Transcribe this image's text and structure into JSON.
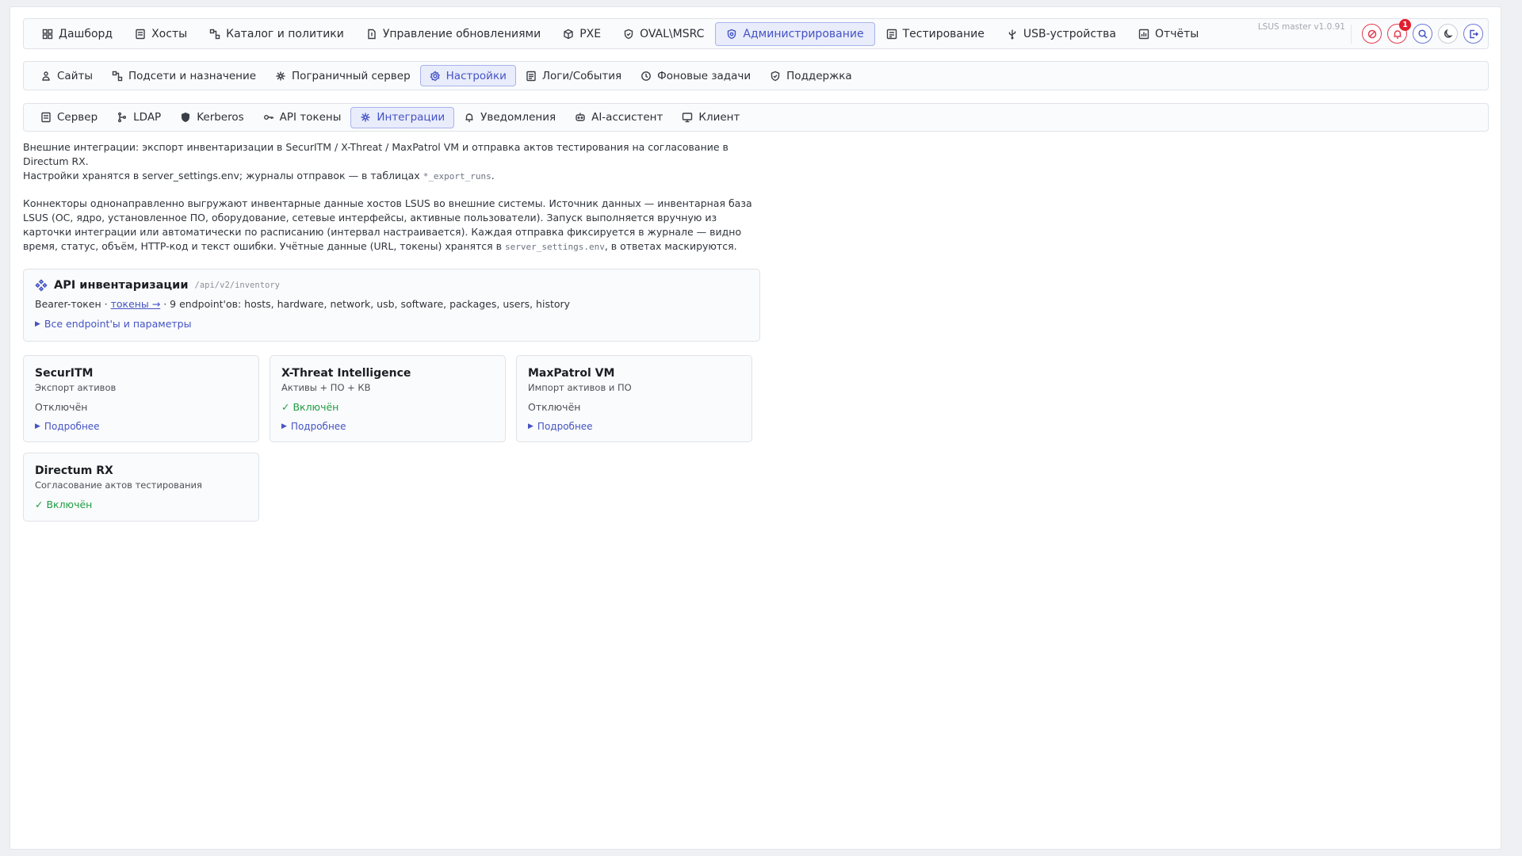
{
  "header": {
    "nav": [
      {
        "label": "Дашборд",
        "icon": "dashboard-icon"
      },
      {
        "label": "Хосты",
        "icon": "server-icon"
      },
      {
        "label": "Каталог и политики",
        "icon": "network-icon"
      },
      {
        "label": "Управление обновлениями",
        "icon": "file-icon"
      },
      {
        "label": "PXE",
        "icon": "box-icon"
      },
      {
        "label": "OVAL\\MSRC",
        "icon": "shield-icon"
      },
      {
        "label": "Администрирование",
        "icon": "gear-shield-icon",
        "active": true
      },
      {
        "label": "Тестирование",
        "icon": "checklist-icon"
      },
      {
        "label": "USB-устройства",
        "icon": "usb-icon"
      },
      {
        "label": "Отчёты",
        "icon": "chart-icon"
      }
    ],
    "version": "LSUS master v1.0.91",
    "notification_count": "1"
  },
  "subnav": [
    {
      "label": "Сайты",
      "icon": "sites-icon"
    },
    {
      "label": "Подсети и назначение",
      "icon": "network-icon"
    },
    {
      "label": "Пограничный сервер",
      "icon": "edge-icon"
    },
    {
      "label": "Настройки",
      "icon": "gear-icon",
      "active": true
    },
    {
      "label": "Логи/События",
      "icon": "log-icon"
    },
    {
      "label": "Фоновые задачи",
      "icon": "clock-icon"
    },
    {
      "label": "Поддержка",
      "icon": "shield-icon"
    }
  ],
  "settings_tabs": [
    {
      "label": "Сервер",
      "icon": "server-icon"
    },
    {
      "label": "LDAP",
      "icon": "tree-icon"
    },
    {
      "label": "Kerberos",
      "icon": "shield-icon"
    },
    {
      "label": "API токены",
      "icon": "key-icon"
    },
    {
      "label": "Интеграции",
      "icon": "integrations-icon",
      "active": true
    },
    {
      "label": "Уведомления",
      "icon": "bell-icon"
    },
    {
      "label": "AI-ассистент",
      "icon": "robot-icon"
    },
    {
      "label": "Клиент",
      "icon": "client-icon"
    }
  ],
  "intro": {
    "line1_a": "Внешние интеграции: экспорт инвентаризации в SecurITM / X-Threat / MaxPatrol VM и отправка актов тестирования на согласование в Directum RX.",
    "line1_b": "Настройки хранятся в server_settings.env; журналы отправок — в таблицах ",
    "line1_code": "*_export_runs",
    "line1_end": ".",
    "para2_a": "Коннекторы однонаправленно выгружают инвентарные данные хостов LSUS во внешние системы. Источник данных — инвентарная база LSUS (ОС, ядро, установленное ПО, оборудование, сетевые интерфейсы, активные пользователи). Запуск выполняется вручную из карточки интеграции или автоматически по расписанию (интервал настраивается). Каждая отправка фиксируется в журнале — видно время, статус, объём, HTTP-код и текст ошибки. Учётные данные (URL, токены) хранятся в ",
    "para2_code": "server_settings.env",
    "para2_b": ", в ответах маскируются."
  },
  "api_card": {
    "title": "API инвентаризации",
    "path": "/api/v2/inventory",
    "line_prefix": "Bearer-токен · ",
    "tokens_link": "токены →",
    "line_suffix": " · 9 endpoint'ов: hosts, hardware, network, usb, software, packages, users, history",
    "toggle": "Все endpoint'ы и параметры"
  },
  "integrations": [
    {
      "name": "SecurITM",
      "subtitle": "Экспорт активов",
      "status": "Отключён",
      "enabled": false,
      "toggle": "Подробнее"
    },
    {
      "name": "X-Threat Intelligence",
      "subtitle": "Активы + ПО + КВ",
      "status": "✓ Включён",
      "enabled": true,
      "toggle": "Подробнее"
    },
    {
      "name": "MaxPatrol VM",
      "subtitle": "Импорт активов и ПО",
      "status": "Отключён",
      "enabled": false,
      "toggle": "Подробнее"
    },
    {
      "name": "Directum RX",
      "subtitle": "Согласование актов тестирования",
      "status": "✓ Включён",
      "enabled": true
    }
  ],
  "colors": {
    "accent": "#4453c4",
    "enabled": "#1f9d43",
    "danger": "#e11d2e"
  }
}
